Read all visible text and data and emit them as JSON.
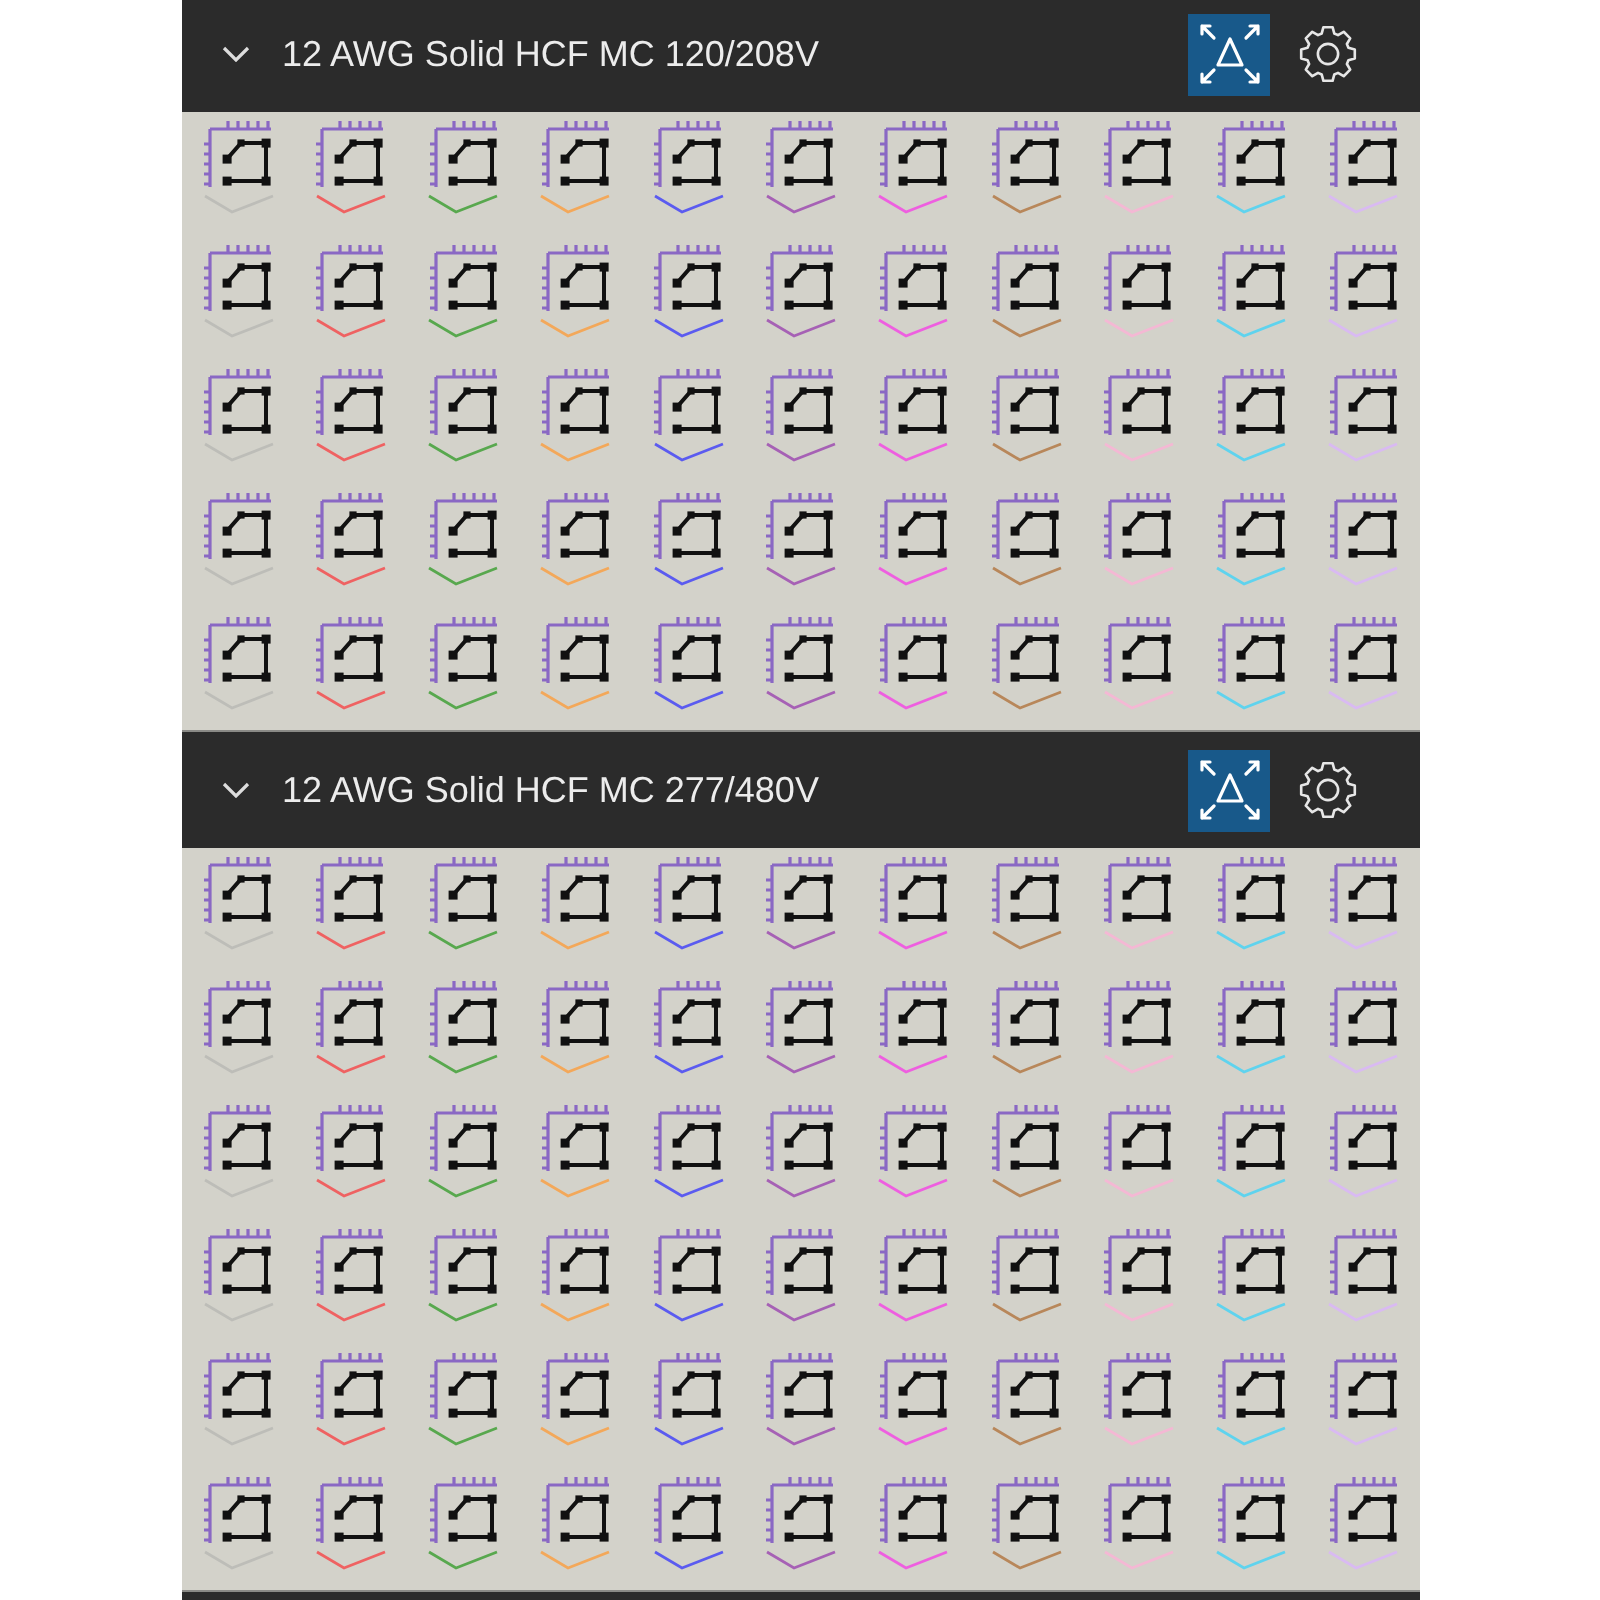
{
  "sections": [
    {
      "title": "12 AWG Solid HCF MC 120/208V",
      "expanded": true,
      "fit_button": {
        "on": true
      },
      "rows": [
        {
          "items": [
            {
              "color": "#bdbdb8"
            },
            {
              "color": "#ef6262"
            },
            {
              "color": "#58a84e"
            },
            {
              "color": "#f3a85a"
            },
            {
              "color": "#5b5bf0"
            },
            {
              "color": "#a661b5"
            },
            {
              "color": "#ee5fe0"
            },
            {
              "color": "#b8875a"
            },
            {
              "color": "#f4b8d4"
            },
            {
              "color": "#5fd3ee"
            },
            {
              "color": "#d9baf2"
            }
          ]
        },
        {
          "items": [
            {
              "color": "#bdbdb8"
            },
            {
              "color": "#ef6262"
            },
            {
              "color": "#58a84e"
            },
            {
              "color": "#f3a85a"
            },
            {
              "color": "#5b5bf0"
            },
            {
              "color": "#a661b5"
            },
            {
              "color": "#ee5fe0"
            },
            {
              "color": "#b8875a"
            },
            {
              "color": "#f4b8d4"
            },
            {
              "color": "#5fd3ee"
            },
            {
              "color": "#d9baf2"
            }
          ]
        },
        {
          "items": [
            {
              "color": "#bdbdb8"
            },
            {
              "color": "#ef6262"
            },
            {
              "color": "#58a84e"
            },
            {
              "color": "#f3a85a"
            },
            {
              "color": "#5b5bf0"
            },
            {
              "color": "#a661b5"
            },
            {
              "color": "#ee5fe0"
            },
            {
              "color": "#b8875a"
            },
            {
              "color": "#f4b8d4"
            },
            {
              "color": "#5fd3ee"
            },
            {
              "color": "#d9baf2"
            }
          ]
        },
        {
          "items": [
            {
              "color": "#bdbdb8"
            },
            {
              "color": "#ef6262"
            },
            {
              "color": "#58a84e"
            },
            {
              "color": "#f3a85a"
            },
            {
              "color": "#5b5bf0"
            },
            {
              "color": "#a661b5"
            },
            {
              "color": "#ee5fe0"
            },
            {
              "color": "#b8875a"
            },
            {
              "color": "#f4b8d4"
            },
            {
              "color": "#5fd3ee"
            },
            {
              "color": "#d9baf2"
            }
          ]
        },
        {
          "items": [
            {
              "color": "#bdbdb8"
            },
            {
              "color": "#ef6262"
            },
            {
              "color": "#58a84e"
            },
            {
              "color": "#f3a85a"
            },
            {
              "color": "#5b5bf0"
            },
            {
              "color": "#a661b5"
            },
            {
              "color": "#ee5fe0"
            },
            {
              "color": "#b8875a"
            },
            {
              "color": "#f4b8d4"
            },
            {
              "color": "#5fd3ee"
            },
            {
              "color": "#d9baf2"
            }
          ]
        }
      ]
    },
    {
      "title": "12 AWG Solid HCF MC 277/480V",
      "expanded": true,
      "fit_button": {
        "on": true
      },
      "rows": [
        {
          "items": [
            {
              "color": "#bdbdb8"
            },
            {
              "color": "#ef6262"
            },
            {
              "color": "#58a84e"
            },
            {
              "color": "#f3a85a"
            },
            {
              "color": "#5b5bf0"
            },
            {
              "color": "#a661b5"
            },
            {
              "color": "#ee5fe0"
            },
            {
              "color": "#b8875a"
            },
            {
              "color": "#f4b8d4"
            },
            {
              "color": "#5fd3ee"
            },
            {
              "color": "#d9baf2"
            }
          ]
        },
        {
          "items": [
            {
              "color": "#bdbdb8"
            },
            {
              "color": "#ef6262"
            },
            {
              "color": "#58a84e"
            },
            {
              "color": "#f3a85a"
            },
            {
              "color": "#5b5bf0"
            },
            {
              "color": "#a661b5"
            },
            {
              "color": "#ee5fe0"
            },
            {
              "color": "#b8875a"
            },
            {
              "color": "#f4b8d4"
            },
            {
              "color": "#5fd3ee"
            },
            {
              "color": "#d9baf2"
            }
          ]
        },
        {
          "items": [
            {
              "color": "#bdbdb8"
            },
            {
              "color": "#ef6262"
            },
            {
              "color": "#58a84e"
            },
            {
              "color": "#f3a85a"
            },
            {
              "color": "#5b5bf0"
            },
            {
              "color": "#a661b5"
            },
            {
              "color": "#ee5fe0"
            },
            {
              "color": "#b8875a"
            },
            {
              "color": "#f4b8d4"
            },
            {
              "color": "#5fd3ee"
            },
            {
              "color": "#d9baf2"
            }
          ]
        },
        {
          "items": [
            {
              "color": "#bdbdb8"
            },
            {
              "color": "#ef6262"
            },
            {
              "color": "#58a84e"
            },
            {
              "color": "#f3a85a"
            },
            {
              "color": "#5b5bf0"
            },
            {
              "color": "#a661b5"
            },
            {
              "color": "#ee5fe0"
            },
            {
              "color": "#b8875a"
            },
            {
              "color": "#f4b8d4"
            },
            {
              "color": "#5fd3ee"
            },
            {
              "color": "#d9baf2"
            }
          ]
        },
        {
          "items": [
            {
              "color": "#bdbdb8"
            },
            {
              "color": "#ef6262"
            },
            {
              "color": "#58a84e"
            },
            {
              "color": "#f3a85a"
            },
            {
              "color": "#5b5bf0"
            },
            {
              "color": "#a661b5"
            },
            {
              "color": "#ee5fe0"
            },
            {
              "color": "#b8875a"
            },
            {
              "color": "#f4b8d4"
            },
            {
              "color": "#5fd3ee"
            },
            {
              "color": "#d9baf2"
            }
          ]
        },
        {
          "items": [
            {
              "color": "#bdbdb8"
            },
            {
              "color": "#ef6262"
            },
            {
              "color": "#58a84e"
            },
            {
              "color": "#f3a85a"
            },
            {
              "color": "#5b5bf0"
            },
            {
              "color": "#a661b5"
            },
            {
              "color": "#ee5fe0"
            },
            {
              "color": "#b8875a"
            },
            {
              "color": "#f4b8d4"
            },
            {
              "color": "#5fd3ee"
            },
            {
              "color": "#d9baf2"
            }
          ]
        }
      ]
    }
  ]
}
